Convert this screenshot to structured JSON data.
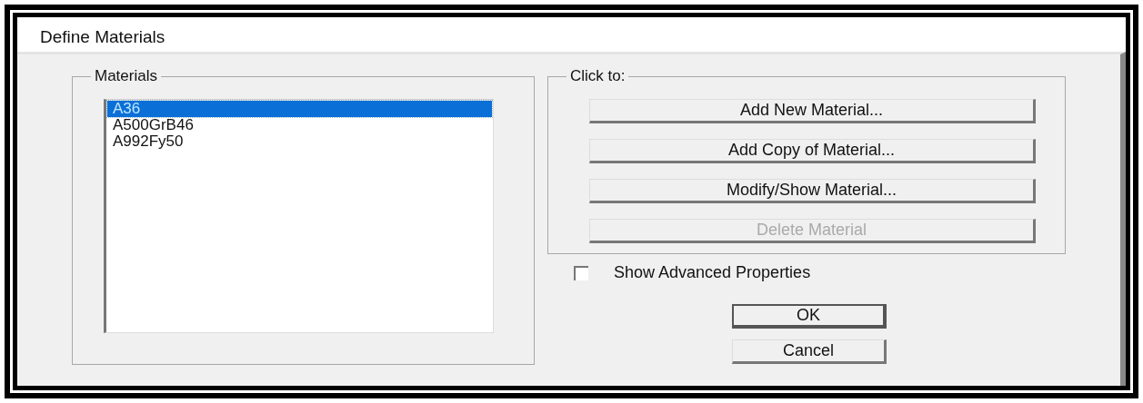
{
  "window": {
    "title": "Define Materials"
  },
  "materials": {
    "label": "Materials",
    "items": [
      {
        "name": "A36",
        "selected": true
      },
      {
        "name": "A500GrB46",
        "selected": false
      },
      {
        "name": "A992Fy50",
        "selected": false
      }
    ]
  },
  "actions": {
    "label": "Click to:",
    "buttons": [
      {
        "label": "Add New Material...",
        "disabled": false
      },
      {
        "label": "Add Copy of Material...",
        "disabled": false
      },
      {
        "label": "Modify/Show Material...",
        "disabled": false
      },
      {
        "label": "Delete Material",
        "disabled": true
      }
    ]
  },
  "show_advanced": {
    "label": "Show Advanced Properties",
    "checked": false
  },
  "buttons": [
    {
      "label": "OK",
      "default": true
    },
    {
      "label": "Cancel",
      "default": false
    }
  ]
}
